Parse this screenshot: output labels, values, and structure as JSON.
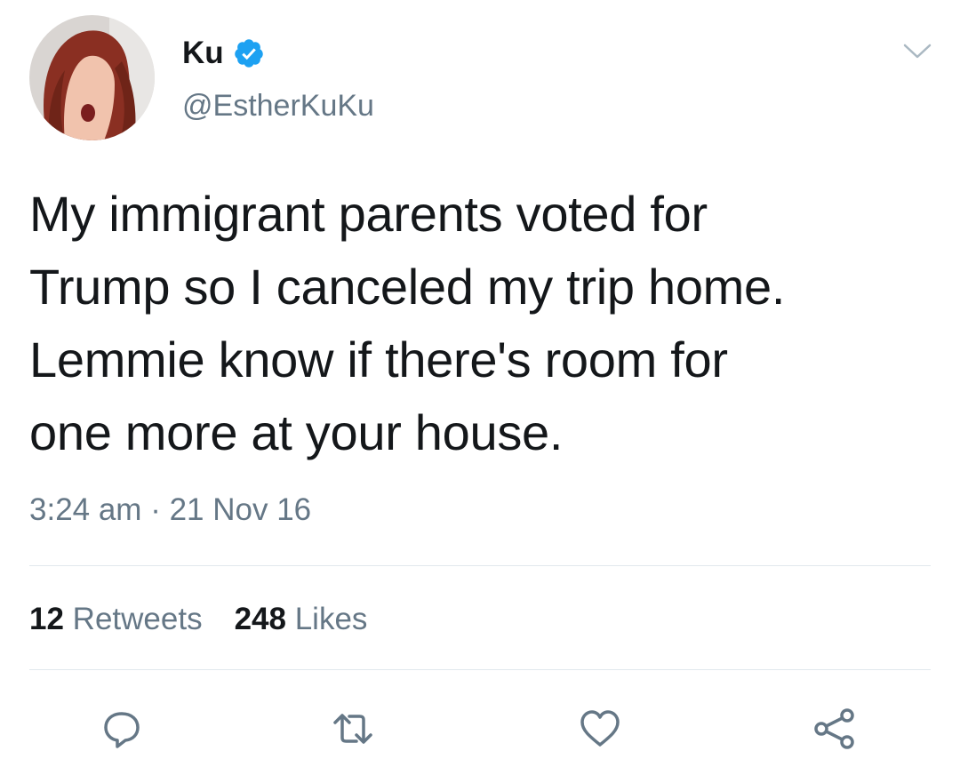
{
  "tweet": {
    "display_name": "Ku",
    "handle": "@EstherKuKu",
    "verified": true,
    "lines": [
      "My immigrant parents voted for",
      "Trump so I canceled my trip home.",
      "Lemmie know if there's room for",
      "one more at your house."
    ],
    "time": "3:24 am",
    "separator": "·",
    "date": "21 Nov 16"
  },
  "stats": {
    "retweets_count": "12",
    "retweets_label": "Retweets",
    "likes_count": "248",
    "likes_label": "Likes"
  },
  "icons": {
    "verified": "verified-badge-icon",
    "menu": "chevron-down-icon",
    "reply": "reply-icon",
    "retweet": "retweet-icon",
    "like": "heart-icon",
    "share": "share-icon"
  },
  "colors": {
    "verified_blue": "#1da1f2",
    "secondary_text": "#657786",
    "primary_text": "#14171a",
    "divider": "#e1e8ed"
  }
}
